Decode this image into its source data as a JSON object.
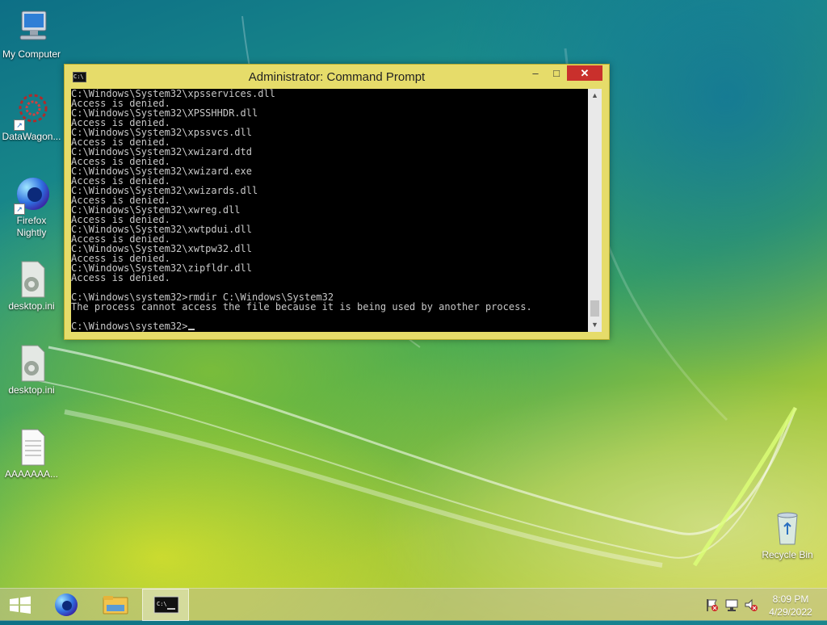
{
  "desktop": {
    "icons": [
      {
        "label": "My Computer",
        "icon": "computer-icon"
      },
      {
        "label": "DataWagon...",
        "icon": "datawagon-icon"
      },
      {
        "label": "Firefox Nightly",
        "icon": "firefox-nightly-icon"
      },
      {
        "label": "desktop.ini",
        "icon": "config-file-icon"
      },
      {
        "label": "desktop.ini",
        "icon": "config-file-icon"
      },
      {
        "label": "AAAAAAA...",
        "icon": "text-document-icon"
      },
      {
        "label": "Recycle Bin",
        "icon": "recycle-bin-icon"
      }
    ]
  },
  "window": {
    "title": "Administrator: Command Prompt",
    "minimize_glyph": "–",
    "maximize_glyph": "□",
    "close_glyph": "✕",
    "console_lines": [
      "C:\\Windows\\System32\\xpsservices.dll",
      "Access is denied.",
      "C:\\Windows\\System32\\XPSSHHDR.dll",
      "Access is denied.",
      "C:\\Windows\\System32\\xpssvcs.dll",
      "Access is denied.",
      "C:\\Windows\\System32\\xwizard.dtd",
      "Access is denied.",
      "C:\\Windows\\System32\\xwizard.exe",
      "Access is denied.",
      "C:\\Windows\\System32\\xwizards.dll",
      "Access is denied.",
      "C:\\Windows\\System32\\xwreg.dll",
      "Access is denied.",
      "C:\\Windows\\System32\\xwtpdui.dll",
      "Access is denied.",
      "C:\\Windows\\System32\\xwtpw32.dll",
      "Access is denied.",
      "C:\\Windows\\System32\\zipfldr.dll",
      "Access is denied.",
      "",
      "C:\\Windows\\system32>rmdir C:\\Windows\\System32",
      "The process cannot access the file because it is being used by another process.",
      ""
    ],
    "prompt": "C:\\Windows\\system32>"
  },
  "taskbar": {
    "buttons": [
      {
        "icon": "windows-start-icon"
      },
      {
        "icon": "firefox-nightly-icon"
      },
      {
        "icon": "file-explorer-icon"
      },
      {
        "icon": "command-prompt-icon"
      }
    ],
    "tray": [
      "action-center-flag-icon",
      "network-icon",
      "volume-muted-icon"
    ],
    "time": "8:09 PM",
    "date": "4/29/2022"
  },
  "colors": {
    "window_frame": "#e6dc6a",
    "close_button": "#c9302c",
    "console_background": "#000000",
    "console_text": "#c8c8c8"
  }
}
